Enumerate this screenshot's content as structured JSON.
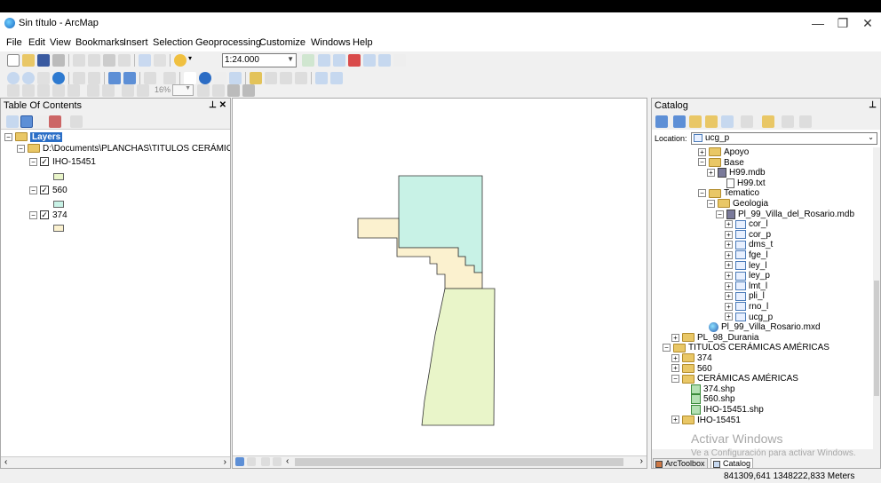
{
  "window": {
    "title": "Sin título - ArcMap",
    "minimize": "—",
    "maximize": "❐",
    "close": "✕"
  },
  "menu": [
    "File",
    "Edit",
    "View",
    "Bookmarks",
    "Insert",
    "Selection",
    "Geoprocessing",
    "Customize",
    "Windows",
    "Help"
  ],
  "toolbar": {
    "scale": "1:24.000",
    "zoom_percent": "16%"
  },
  "toc": {
    "title": "Table Of Contents",
    "root": "Layers",
    "path": "D:\\Documents\\PLANCHAS\\TITULOS CERÁMICAS A",
    "layers": [
      {
        "name": "IHO-15451",
        "color": "#e9f5c9"
      },
      {
        "name": "560",
        "color": "#c8f2e6"
      },
      {
        "name": "374",
        "color": "#fbf1cf"
      }
    ]
  },
  "catalog": {
    "title": "Catalog",
    "location_label": "Location:",
    "location_value": "ucg_p",
    "items": [
      {
        "label": "Apoyo",
        "icon": "folder",
        "indent": 6,
        "pm": "+"
      },
      {
        "label": "Base",
        "icon": "folder",
        "indent": 6,
        "pm": "-"
      },
      {
        "label": "H99.mdb",
        "icon": "db",
        "indent": 7,
        "pm": "+"
      },
      {
        "label": "H99.txt",
        "icon": "txt",
        "indent": 8,
        "pm": ""
      },
      {
        "label": "Tematico",
        "icon": "folder",
        "indent": 6,
        "pm": "-"
      },
      {
        "label": "Geologia",
        "icon": "folder",
        "indent": 7,
        "pm": "-"
      },
      {
        "label": "Pl_99_Villa_del_Rosario.mdb",
        "icon": "db",
        "indent": 8,
        "pm": "-"
      },
      {
        "label": "cor_l",
        "icon": "fc",
        "indent": 9,
        "pm": "+"
      },
      {
        "label": "cor_p",
        "icon": "fc",
        "indent": 9,
        "pm": "+"
      },
      {
        "label": "dms_t",
        "icon": "fc",
        "indent": 9,
        "pm": "+"
      },
      {
        "label": "fge_l",
        "icon": "fc",
        "indent": 9,
        "pm": "+"
      },
      {
        "label": "ley_l",
        "icon": "fc",
        "indent": 9,
        "pm": "+"
      },
      {
        "label": "ley_p",
        "icon": "fc",
        "indent": 9,
        "pm": "+"
      },
      {
        "label": "lmt_l",
        "icon": "fc",
        "indent": 9,
        "pm": "+"
      },
      {
        "label": "pli_l",
        "icon": "fc",
        "indent": 9,
        "pm": "+"
      },
      {
        "label": "rno_l",
        "icon": "fc",
        "indent": 9,
        "pm": "+"
      },
      {
        "label": "ucg_p",
        "icon": "fc",
        "indent": 9,
        "pm": "+"
      },
      {
        "label": "Pl_99_Villa_Rosario.mxd",
        "icon": "mxd",
        "indent": 6,
        "pm": ""
      },
      {
        "label": "PL_98_Durania",
        "icon": "folder",
        "indent": 3,
        "pm": "+"
      },
      {
        "label": "TITULOS CERÁMICAS AMÉRICAS",
        "icon": "folder",
        "indent": 2,
        "pm": "-"
      },
      {
        "label": "374",
        "icon": "folder",
        "indent": 3,
        "pm": "+"
      },
      {
        "label": "560",
        "icon": "folder",
        "indent": 3,
        "pm": "+"
      },
      {
        "label": "CERÁMICAS AMÉRICAS",
        "icon": "folder",
        "indent": 3,
        "pm": "-"
      },
      {
        "label": "374.shp",
        "icon": "shp",
        "indent": 4,
        "pm": ""
      },
      {
        "label": "560.shp",
        "icon": "shp",
        "indent": 4,
        "pm": ""
      },
      {
        "label": "IHO-15451.shp",
        "icon": "shp",
        "indent": 4,
        "pm": ""
      },
      {
        "label": "IHO-15451",
        "icon": "folder",
        "indent": 3,
        "pm": "+"
      }
    ],
    "tabs": [
      "ArcToolbox",
      "Catalog"
    ]
  },
  "watermark": {
    "line1": "Activar Windows",
    "line2": "Ve a Configuración para activar Windows."
  },
  "status": {
    "coords": "841309,641  1348222,833 Meters"
  }
}
